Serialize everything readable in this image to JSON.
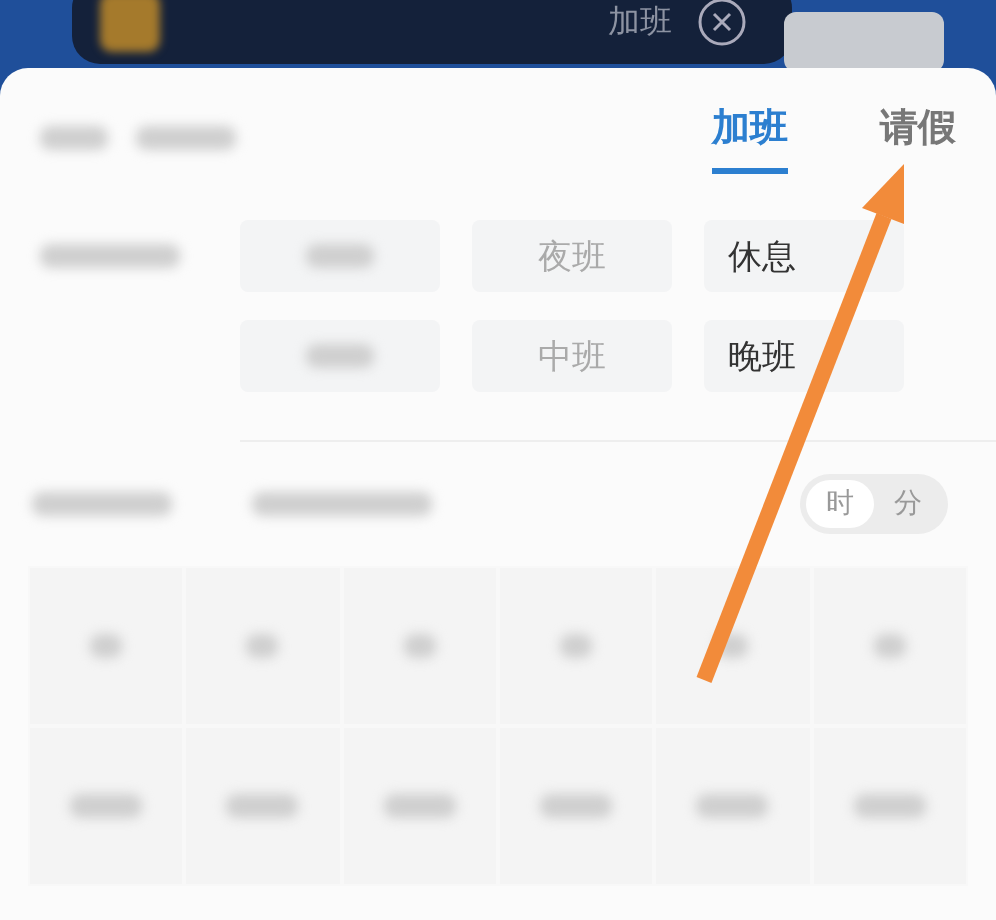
{
  "banner": {
    "title": "加班"
  },
  "tabs": [
    {
      "label": "加班",
      "selected": true
    },
    {
      "label": "请假",
      "selected": false
    }
  ],
  "shift_options": [
    {
      "kind": "blurred"
    },
    {
      "kind": "text",
      "label": "夜班",
      "dim": true
    },
    {
      "kind": "text",
      "label": "休息",
      "dim": false
    },
    {
      "kind": "blurred"
    },
    {
      "kind": "text",
      "label": "中班",
      "dim": true
    },
    {
      "kind": "text",
      "label": "晚班",
      "dim": false
    }
  ],
  "unit_toggle": [
    {
      "label": "时",
      "selected": true
    },
    {
      "label": "分",
      "selected": false
    }
  ],
  "annotation": {
    "kind": "arrow"
  }
}
